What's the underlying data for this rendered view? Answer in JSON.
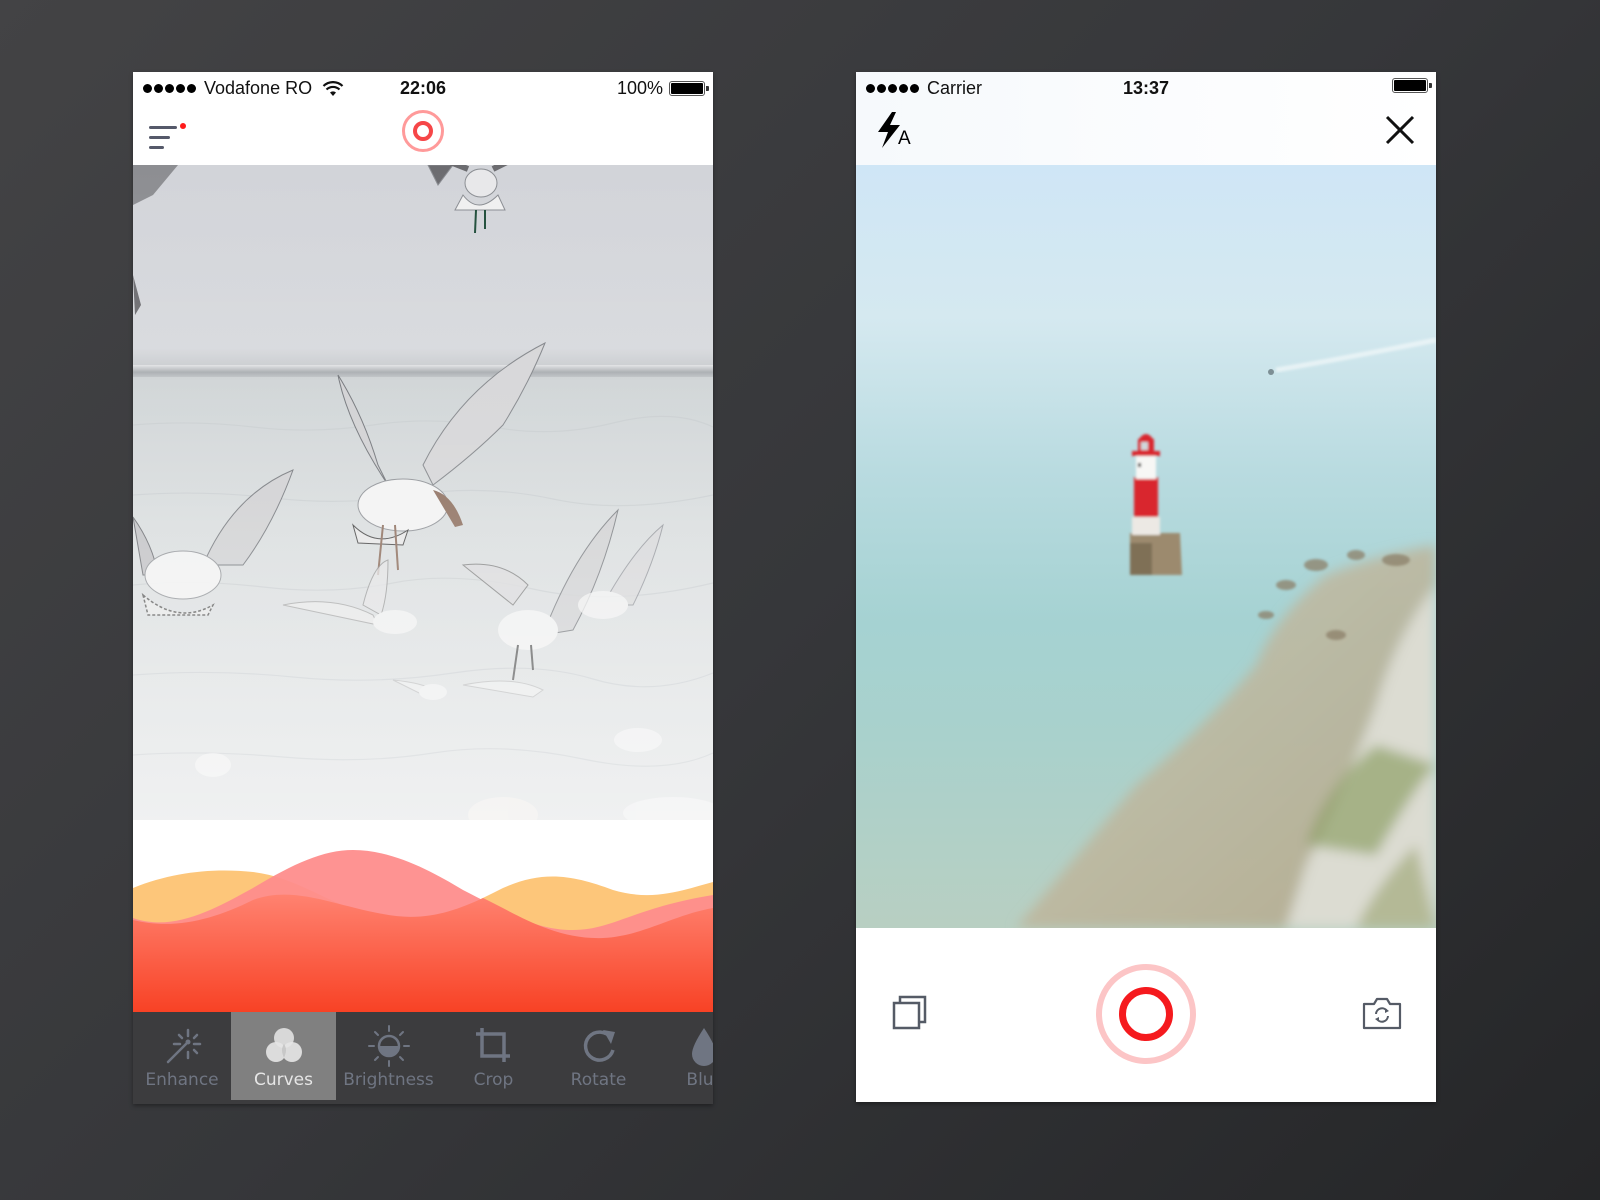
{
  "left_screen": {
    "status_bar": {
      "signal_dots": 5,
      "carrier": "Vodafone RO",
      "time": "22:06",
      "battery_percent": "100%",
      "battery_level": 1.0
    },
    "nav": {
      "menu_icon": "hamburger-menu-icon",
      "menu_badge": "notification-dot",
      "logo_icon": "target-ring-logo"
    },
    "photo": {
      "subject": "seagulls over sea"
    },
    "curves_panel": {
      "colors": {
        "yellow_wave": "#fdc67a",
        "pink_wave": "#fe8d8c",
        "red_gradient_top": "#ff7a68",
        "red_gradient_bottom": "#f84225"
      }
    },
    "toolbar": {
      "tabs": [
        {
          "label": "Enhance",
          "icon": "magic-wand-icon",
          "active": false
        },
        {
          "label": "Curves",
          "icon": "color-circles-icon",
          "active": true
        },
        {
          "label": "Brightness",
          "icon": "brightness-sun-icon",
          "active": false
        },
        {
          "label": "Crop",
          "icon": "crop-icon",
          "active": false
        },
        {
          "label": "Rotate",
          "icon": "rotate-icon",
          "active": false
        },
        {
          "label": "Blur",
          "icon": "blur-drop-icon",
          "active": false
        }
      ],
      "active_bg": "#808080",
      "bg": "#3c3c3e",
      "label_color": "#6f7582"
    }
  },
  "right_screen": {
    "status_bar": {
      "signal_dots": 5,
      "carrier": "Carrier",
      "time": "13:37",
      "battery_level": 1.0
    },
    "top_bar": {
      "flash_icon": "flash-auto-icon",
      "flash_label": "A",
      "close_icon": "close-icon"
    },
    "photo": {
      "subject": "lighthouse in sea near chalk cliffs"
    },
    "controls": {
      "gallery_icon": "gallery-stack-icon",
      "shutter": "shutter-button",
      "flip_icon": "flip-camera-icon",
      "shutter_color": "#f51a1e",
      "shutter_ring_color": "#fcc5c6"
    }
  }
}
